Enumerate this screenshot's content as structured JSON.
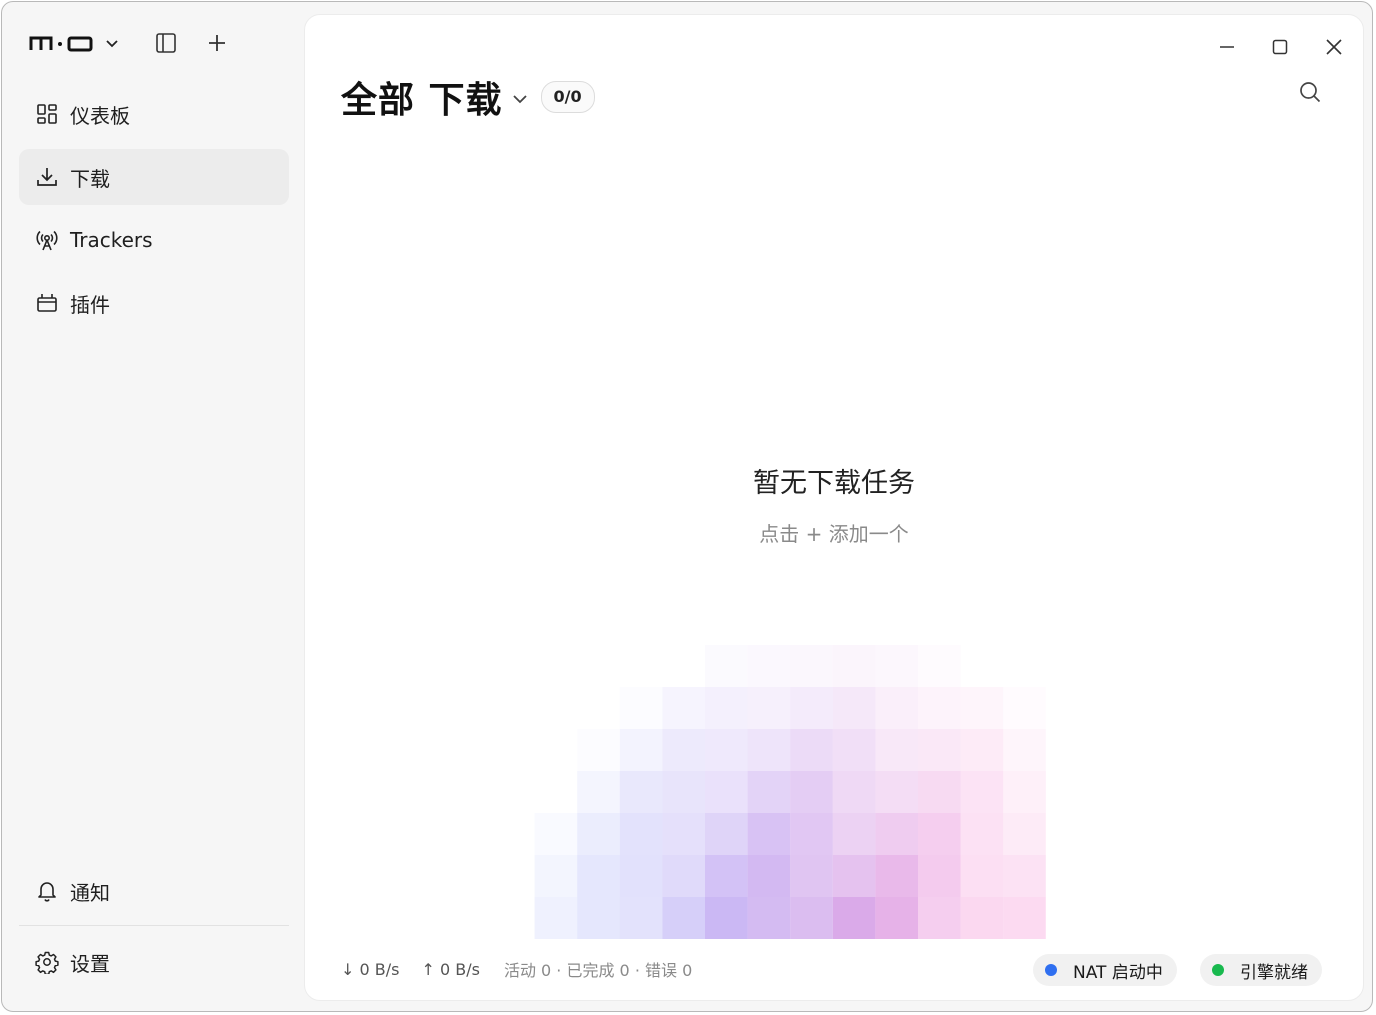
{
  "app": {
    "logo_text": "m·o"
  },
  "sidebar": {
    "items": [
      {
        "label": "仪表板",
        "icon": "dashboard-icon",
        "active": false
      },
      {
        "label": "下载",
        "icon": "download-icon",
        "active": true
      },
      {
        "label": "Trackers",
        "icon": "tracker-antenna-icon",
        "active": false
      },
      {
        "label": "插件",
        "icon": "plugin-icon",
        "active": false
      }
    ],
    "bottom_items": [
      {
        "label": "通知",
        "icon": "bell-icon"
      },
      {
        "label": "设置",
        "icon": "gear-icon"
      }
    ]
  },
  "header": {
    "title": "全部 下载",
    "count": "0/0"
  },
  "empty_state": {
    "title": "暂无下载任务",
    "subtitle": "点击 + 添加一个"
  },
  "status": {
    "download_speed": "↓ 0 B/s",
    "upload_speed": "↑ 0 B/s",
    "summary": "活动 0 · 已完成 0 · 错误 0",
    "nat": {
      "label": "NAT 启动中",
      "color": "#2f6ff0"
    },
    "engine": {
      "label": "引擎就绪",
      "color": "#18b94e"
    }
  },
  "colors": {
    "accent_blue": "#6f9cfb",
    "accent_purple": "#b79cf0",
    "accent_pink": "#f7a8de"
  }
}
